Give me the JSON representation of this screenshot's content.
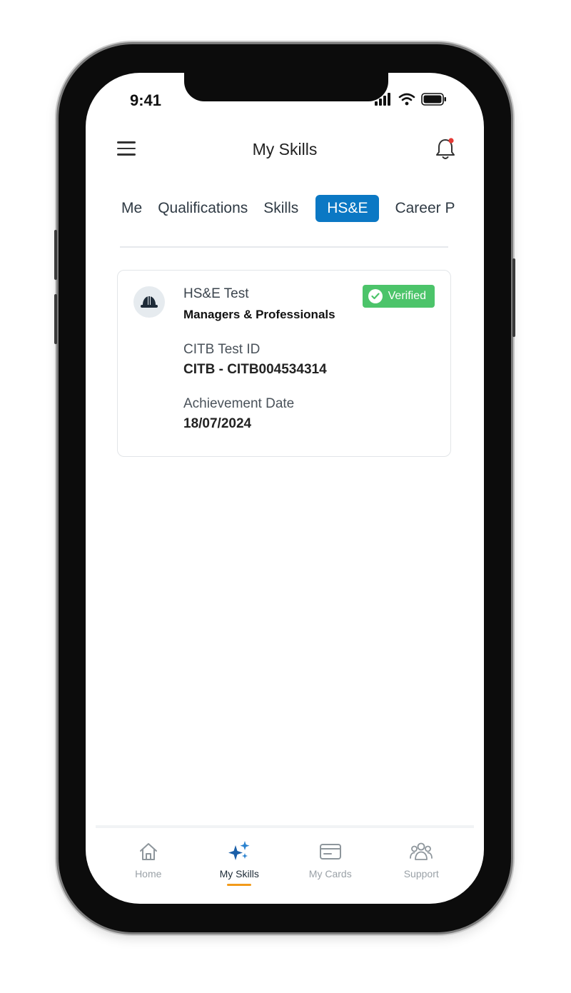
{
  "status_bar": {
    "time": "9:41"
  },
  "header": {
    "title": "My Skills"
  },
  "tabs": [
    {
      "label": "Me",
      "active": false
    },
    {
      "label": "Qualifications",
      "active": false
    },
    {
      "label": "Skills",
      "active": false
    },
    {
      "label": "HS&E",
      "active": true
    },
    {
      "label": "Career P",
      "active": false
    }
  ],
  "card": {
    "icon": "hard-hat-icon",
    "title": "HS&E Test",
    "subtitle": "Managers & Professionals",
    "badge": "Verified",
    "test_id_label": "CITB Test ID",
    "test_id_value": "CITB - CITB004534314",
    "date_label": "Achievement Date",
    "date_value": "18/07/2024"
  },
  "bottom_nav": [
    {
      "label": "Home",
      "icon": "home-icon",
      "active": false
    },
    {
      "label": "My Skills",
      "icon": "sparkles-icon",
      "active": true
    },
    {
      "label": "My Cards",
      "icon": "card-icon",
      "active": false
    },
    {
      "label": "Support",
      "icon": "people-icon",
      "active": false
    }
  ],
  "colors": {
    "accent": "#0b78c4",
    "verified": "#4cc46a",
    "nav_active_underline": "#f29a1a"
  }
}
